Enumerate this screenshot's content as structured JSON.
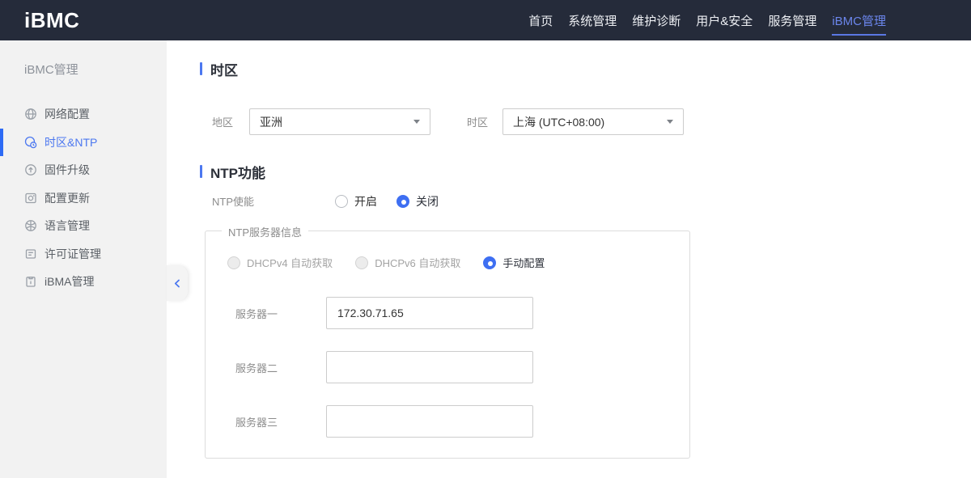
{
  "colors": {
    "accent": "#4c78f0",
    "accent-bright": "#3e6ff2",
    "navbar-bg": "#252b3a",
    "sidebar-bg": "#f2f2f2"
  },
  "header": {
    "logo": "iBMC",
    "nav": [
      {
        "label": "首页",
        "active": false
      },
      {
        "label": "系统管理",
        "active": false
      },
      {
        "label": "维护诊断",
        "active": false
      },
      {
        "label": "用户&安全",
        "active": false
      },
      {
        "label": "服务管理",
        "active": false
      },
      {
        "label": "iBMC管理",
        "active": true
      }
    ]
  },
  "sidebar": {
    "title": "iBMC管理",
    "items": [
      {
        "label": "网络配置",
        "icon": "network-globe-icon",
        "active": false
      },
      {
        "label": "时区&NTP",
        "icon": "timezone-clock-icon",
        "active": true
      },
      {
        "label": "固件升级",
        "icon": "firmware-upgrade-icon",
        "active": false
      },
      {
        "label": "配置更新",
        "icon": "config-update-icon",
        "active": false
      },
      {
        "label": "语言管理",
        "icon": "language-icon",
        "active": false
      },
      {
        "label": "许可证管理",
        "icon": "license-icon",
        "active": false
      },
      {
        "label": "iBMA管理",
        "icon": "ibma-clipboard-icon",
        "active": false
      }
    ],
    "collapse_icon": "chevron-left-icon"
  },
  "main": {
    "timezone_section": {
      "title": "时区",
      "region_label": "地区",
      "region_value": "亚洲",
      "timezone_label": "时区",
      "timezone_value": "上海 (UTC+08:00)"
    },
    "ntp_section": {
      "title": "NTP功能",
      "enable_label": "NTP使能",
      "enable_options": [
        {
          "label": "开启",
          "selected": false
        },
        {
          "label": "关闭",
          "selected": true
        }
      ],
      "server_group": {
        "legend": "NTP服务器信息",
        "mode_options": [
          {
            "label": "DHCPv4 自动获取",
            "disabled": true,
            "selected": false
          },
          {
            "label": "DHCPv6 自动获取",
            "disabled": true,
            "selected": false
          },
          {
            "label": "手动配置",
            "disabled": false,
            "selected": true
          }
        ],
        "servers": [
          {
            "label": "服务器一",
            "value": "172.30.71.65"
          },
          {
            "label": "服务器二",
            "value": ""
          },
          {
            "label": "服务器三",
            "value": ""
          }
        ]
      }
    }
  }
}
